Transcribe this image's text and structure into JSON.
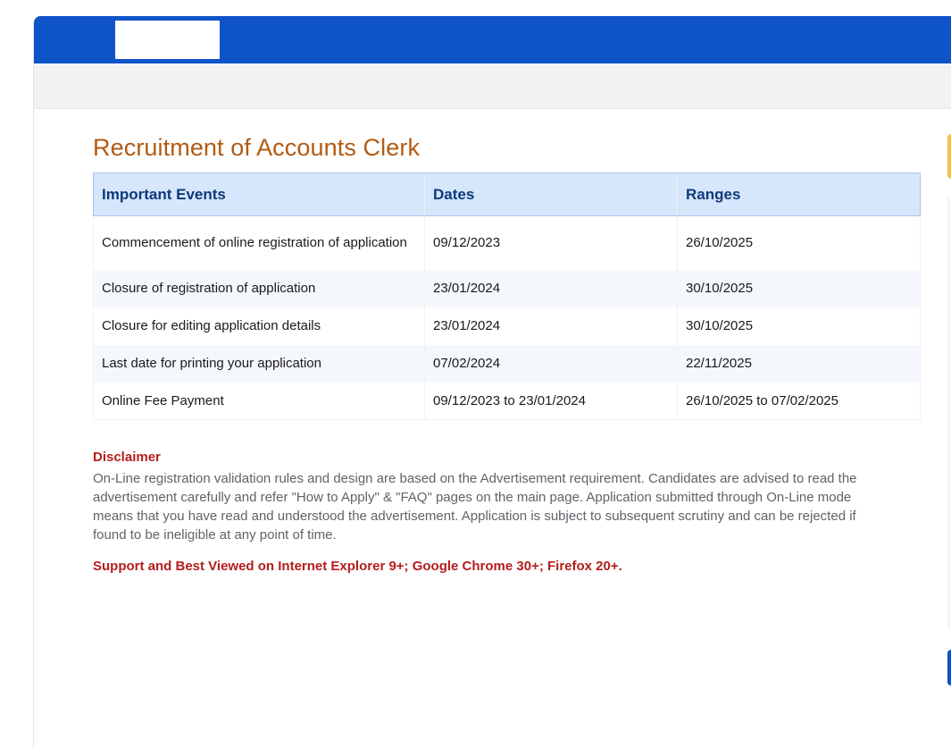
{
  "header": {
    "brand_color": "#0f53c8"
  },
  "page": {
    "title": "Recruitment of Accounts Clerk"
  },
  "events_table": {
    "columns": [
      "Important Events",
      "Dates",
      "Ranges"
    ],
    "rows": [
      {
        "event": "Commencement of online registration of application",
        "date": "09/12/2023",
        "range": "26/10/2025"
      },
      {
        "event": "Closure of registration of application",
        "date": "23/01/2024",
        "range": "30/10/2025"
      },
      {
        "event": "Closure for editing application details",
        "date": "23/01/2024",
        "range": "30/10/2025"
      },
      {
        "event": "Last date for printing your application",
        "date": "07/02/2024",
        "range": "22/11/2025"
      },
      {
        "event": "Online Fee Payment",
        "date": "09/12/2023 to 23/01/2024",
        "range": "26/10/2025 to 07/02/2025"
      }
    ]
  },
  "disclaimer": {
    "title": "Disclaimer",
    "text": "On-Line registration validation rules and design are based on the Advertisement requirement. Candidates are advised to read the advertisement carefully and refer \"How to Apply\" & \"FAQ\" pages on the main page. Application submitted through On-Line mode means that you have read and understood the advertisement. Application is subject to subsequent scrutiny and can be rejected if found to be ineligible at any point of time."
  },
  "support_note": "Support and Best Viewed on Internet Explorer 9+; Google Chrome 30+; Firefox 20+."
}
